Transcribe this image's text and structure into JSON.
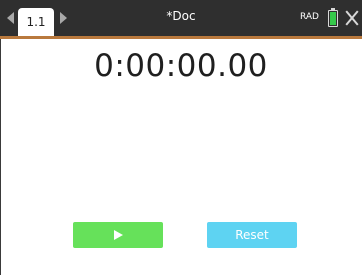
{
  "topbar": {
    "tab_label": "1.1",
    "doc_title": "*Doc",
    "angle_mode": "RAD",
    "battery_level": 0.85,
    "colors": {
      "bar": "#2f2f2f",
      "accent": "#b9793d",
      "battery": "#35c94a"
    }
  },
  "timer": {
    "display": "0:00:00.00"
  },
  "controls": {
    "play_icon": "play-icon",
    "reset_label": "Reset",
    "colors": {
      "play": "#66e15a",
      "reset": "#5ed3f2"
    }
  }
}
